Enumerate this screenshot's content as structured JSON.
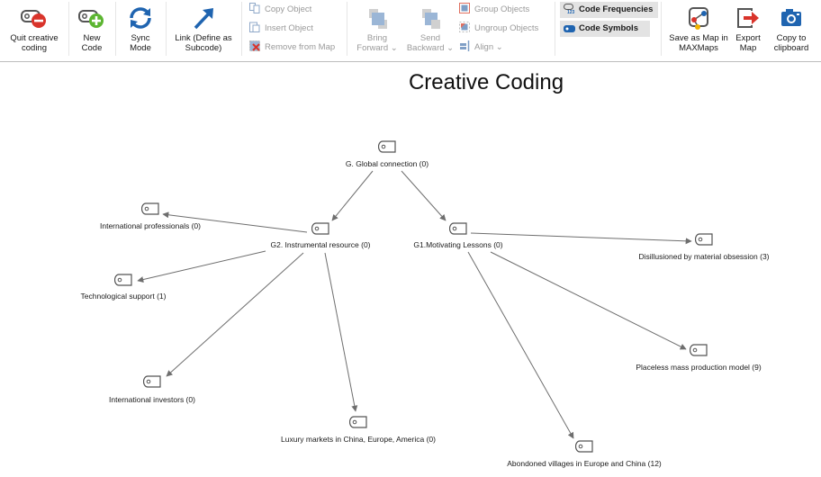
{
  "toolbar": {
    "quit": {
      "label": "Quit creative coding",
      "line1": "Quit creative",
      "line2": "coding",
      "icon": "code-remove-icon"
    },
    "new_code": {
      "line1": "New",
      "line2": "Code",
      "icon": "code-add-icon"
    },
    "sync": {
      "line1": "Sync",
      "line2": "Mode",
      "icon": "sync-icon"
    },
    "link": {
      "line1": "Link (Define as",
      "line2": "Subcode)",
      "icon": "arrow-up-right-icon"
    },
    "copy_object": "Copy Object",
    "insert_object": "Insert Object",
    "remove_from_map": "Remove from Map",
    "bring_forward": {
      "line1": "Bring",
      "line2": "Forward"
    },
    "send_backward": {
      "line1": "Send",
      "line2": "Backward"
    },
    "group_objects": "Group Objects",
    "ungroup_objects": "Ungroup Objects",
    "align": "Align",
    "code_frequencies": "Code Frequencies",
    "code_symbols": "Code Symbols",
    "save_maxmaps": {
      "line1": "Save as Map in",
      "line2": "MAXMaps"
    },
    "export_map": {
      "line1": "Export",
      "line2": "Map"
    },
    "copy_clipboard": {
      "line1": "Copy to",
      "line2": "clipboard"
    }
  },
  "colors": {
    "remove_red": "#d9342b",
    "add_green": "#5cb531",
    "sync_blue": "#1f64b0",
    "toggle_bg": "#e3e3e3",
    "edge": "#6e6e6e"
  },
  "map": {
    "title": "Creative Coding",
    "nodes": [
      {
        "id": "g",
        "label": "G. Global connection (0)"
      },
      {
        "id": "g2",
        "label": "G2. Instrumental resource (0)"
      },
      {
        "id": "g1",
        "label": "G1.Motivating Lessons (0)"
      },
      {
        "id": "ip",
        "label": "International professionals (0)"
      },
      {
        "id": "ts",
        "label": "Technological support (1)"
      },
      {
        "id": "ii",
        "label": "International investors (0)"
      },
      {
        "id": "lm",
        "label": "Luxury markets in China, Europe, America (0)"
      },
      {
        "id": "dm",
        "label": "Disillusioned by material obsession (3)"
      },
      {
        "id": "pm",
        "label": "Placeless mass production model (9)"
      },
      {
        "id": "av",
        "label": "Abondoned villages in Europe and China (12)"
      }
    ],
    "edges": [
      {
        "from": "g",
        "to": "g2"
      },
      {
        "from": "g",
        "to": "g1"
      },
      {
        "from": "g2",
        "to": "ip"
      },
      {
        "from": "g2",
        "to": "ts"
      },
      {
        "from": "g2",
        "to": "ii"
      },
      {
        "from": "g2",
        "to": "lm"
      },
      {
        "from": "g1",
        "to": "dm"
      },
      {
        "from": "g1",
        "to": "pm"
      },
      {
        "from": "g1",
        "to": "av"
      }
    ]
  }
}
